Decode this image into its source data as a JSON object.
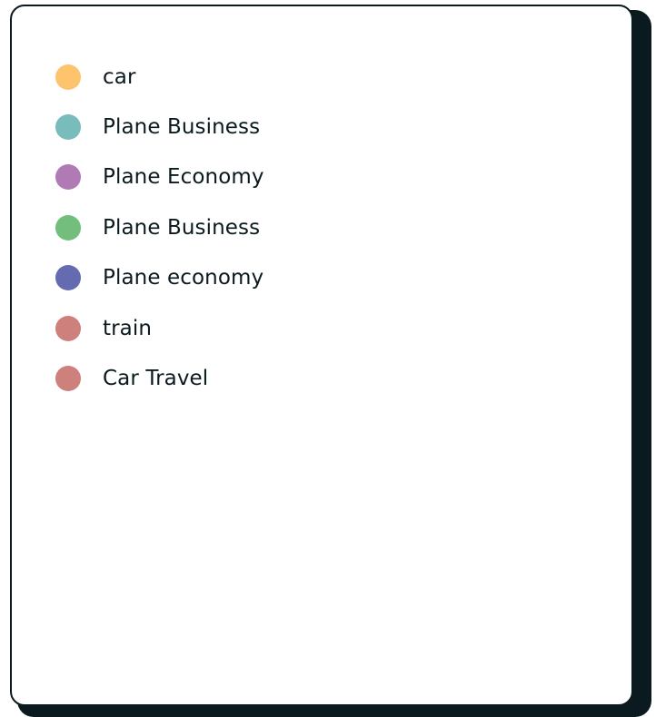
{
  "legend": {
    "items": [
      {
        "label": "car",
        "color": "#fdc46d"
      },
      {
        "label": "Plane Business",
        "color": "#78bcbb"
      },
      {
        "label": "Plane Economy",
        "color": "#b07ab5"
      },
      {
        "label": "Plane Business",
        "color": "#73be7d"
      },
      {
        "label": "Plane economy",
        "color": "#646bb1"
      },
      {
        "label": "train",
        "color": "#cd807c"
      },
      {
        "label": "Car Travel",
        "color": "#cd807c"
      }
    ]
  }
}
